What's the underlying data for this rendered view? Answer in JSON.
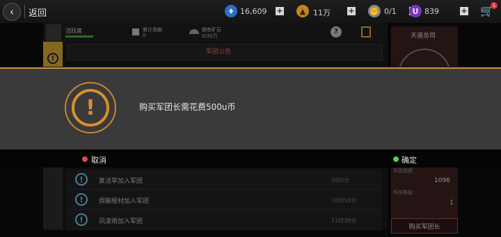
{
  "topbar": {
    "back_label": "返回",
    "resources": [
      {
        "icon": "water-drop-icon",
        "value": "16,609",
        "color": "#3a8be0"
      },
      {
        "icon": "gold-ingot-icon",
        "value": "11万",
        "color": "#d89a26"
      },
      {
        "icon": "fist-icon",
        "value": "0/1",
        "color": "#9a9a9a"
      },
      {
        "icon": "u-coin-icon",
        "value": "839",
        "color": "#8a3ecb"
      }
    ],
    "cart_badge": "1"
  },
  "header": {
    "activity_label": "活跃度",
    "contribution_label": "累计贡献",
    "contribution_value": "0",
    "ore_label": "拥有矿石",
    "ore_value": "0/30万",
    "help_glyph": "?"
  },
  "notice": {
    "title": "军团公告"
  },
  "right_panel": {
    "title": "天道总司",
    "stat1_label": "军团规模",
    "stat1_value": "1096",
    "stat2_label": "科技等级",
    "stat2_value": "1",
    "buy_button": "购买军团长"
  },
  "list": {
    "rows": [
      {
        "text": "复活草加入军团",
        "time": "5时0分"
      },
      {
        "text": "倜躺根材加入军团",
        "time": "10时18分"
      },
      {
        "text": "凤凌雨加入军团",
        "time": "11时38分"
      }
    ]
  },
  "modal": {
    "message": "购买军团长需花费500u币",
    "cancel_label": "取消",
    "confirm_label": "确定",
    "cancel_color": "#e0474c",
    "confirm_color": "#4ccf5a"
  }
}
